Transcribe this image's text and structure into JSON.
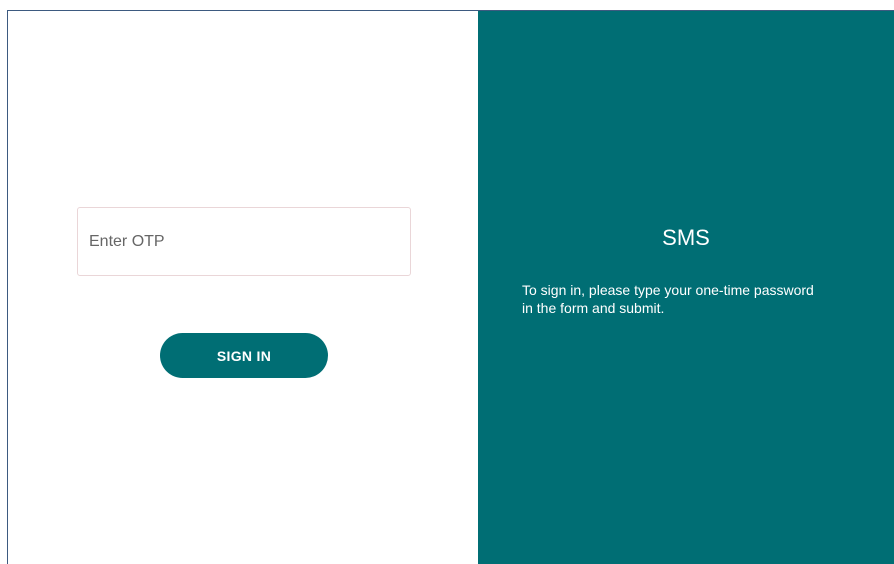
{
  "login_form": {
    "otp_placeholder": "Enter OTP",
    "otp_value": "",
    "sign_in_label": "SIGN IN"
  },
  "info_panel": {
    "title": "SMS",
    "description": "To sign in, please type your one-time password in the form and submit."
  },
  "colors": {
    "accent": "#006e74",
    "panel_text": "#ffffff",
    "input_border": "#ead6d8",
    "frame_border": "#3d5a80"
  }
}
